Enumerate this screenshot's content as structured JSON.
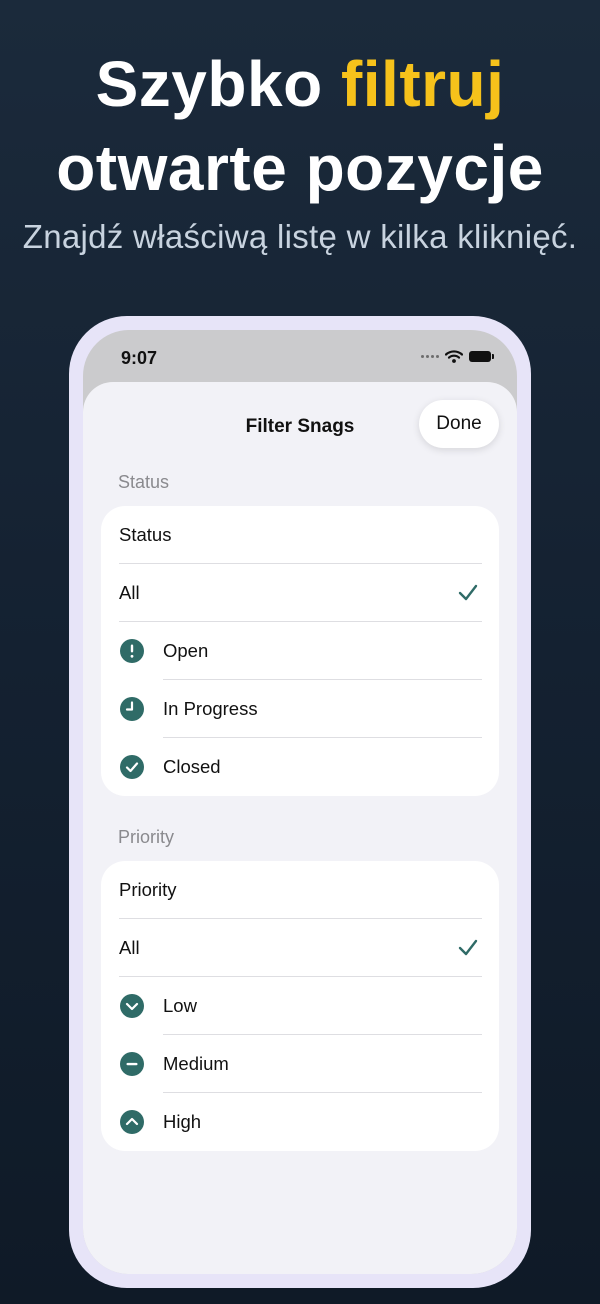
{
  "headline": {
    "line1_prefix": "Szybko ",
    "line1_accent": "filtruj",
    "line2": "otwarte pozycje"
  },
  "subtitle": "Znajdź właściwą listę w kilka kliknięć.",
  "status_bar": {
    "time": "9:07"
  },
  "sheet": {
    "title": "Filter Snags",
    "done_label": "Done"
  },
  "status_section": {
    "header": "Status",
    "title_row": "Status",
    "all_label": "All",
    "all_selected": true,
    "options": [
      {
        "label": "Open",
        "icon": "exclamation-circle-icon"
      },
      {
        "label": "In Progress",
        "icon": "clock-icon"
      },
      {
        "label": "Closed",
        "icon": "check-circle-icon"
      }
    ]
  },
  "priority_section": {
    "header": "Priority",
    "title_row": "Priority",
    "all_label": "All",
    "all_selected": true,
    "options": [
      {
        "label": "Low",
        "icon": "chevron-down-circle-icon"
      },
      {
        "label": "Medium",
        "icon": "minus-circle-icon"
      },
      {
        "label": "High",
        "icon": "chevron-up-circle-icon"
      }
    ]
  },
  "colors": {
    "accent": "#2f6b67",
    "headline_accent": "#f6c21b",
    "frame": "#e7e4f8"
  }
}
